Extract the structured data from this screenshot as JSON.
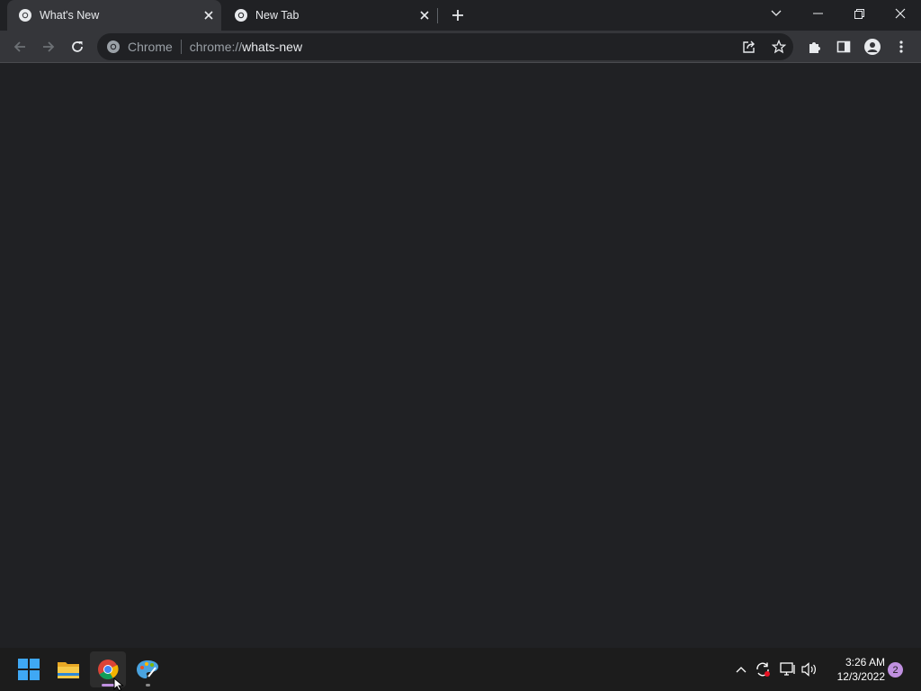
{
  "tabs": [
    {
      "title": "What's New",
      "active": true,
      "icon": "chrome-icon"
    },
    {
      "title": "New Tab",
      "active": false,
      "icon": "chrome-icon"
    }
  ],
  "omnibox": {
    "chip_label": "Chrome",
    "url_scheme": "chrome://",
    "url_host": "whats-new"
  },
  "taskbar": {
    "apps": [
      "windows-start",
      "file-explorer",
      "chrome",
      "paint"
    ],
    "clock_time": "3:26 AM",
    "clock_date": "12/3/2022",
    "notification_count": "2"
  },
  "colors": {
    "background": "#202124",
    "toolbar": "#35363a",
    "taskbar": "#1c1c1c",
    "accent": "#c090e0"
  }
}
